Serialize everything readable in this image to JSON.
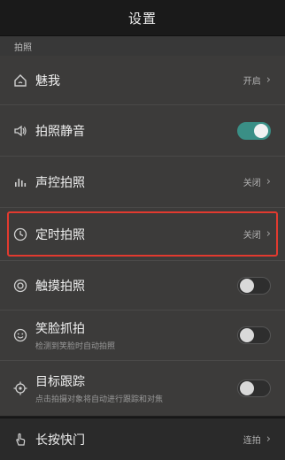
{
  "header": {
    "title": "设置"
  },
  "section": {
    "title": "拍照"
  },
  "rows": [
    {
      "label": "魅我",
      "value": "开启"
    },
    {
      "label": "拍照静音",
      "toggle": "on"
    },
    {
      "label": "声控拍照",
      "value": "关闭"
    },
    {
      "label": "定时拍照",
      "value": "关闭"
    },
    {
      "label": "触摸拍照",
      "toggle": "off"
    },
    {
      "label": "笑脸抓拍",
      "sub": "检测到笑脸时自动拍照",
      "toggle": "off"
    },
    {
      "label": "目标跟踪",
      "sub": "点击拍摄对象将自动进行跟踪和对焦",
      "toggle": "off"
    }
  ],
  "bottom_row": {
    "label": "长按快门",
    "value": "连拍"
  },
  "colors": {
    "toggle_on": "#3a8f86",
    "highlight": "#e23a2f"
  },
  "icons": [
    "home-face-icon",
    "speaker-icon",
    "voice-bars-icon",
    "clock-icon",
    "touch-target-icon",
    "smile-icon",
    "tracking-target-icon",
    "hand-touch-icon"
  ]
}
